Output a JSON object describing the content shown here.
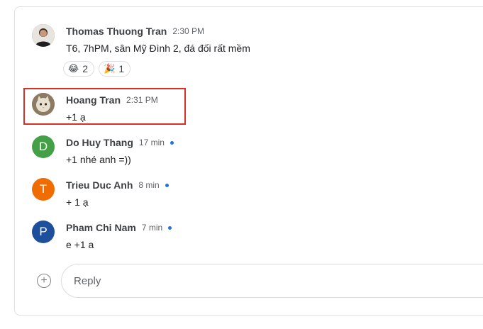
{
  "messages": [
    {
      "author": "Thomas Thuong Tran",
      "time": "2:30 PM",
      "text": "T6, 7hPM, sân Mỹ Đình 2, đá đối rất mềm",
      "avatar_icon": "photo-avatar",
      "reactions": [
        {
          "emoji": "😂",
          "count": "2"
        },
        {
          "emoji": "🎉",
          "count": "1"
        }
      ]
    },
    {
      "author": "Hoang Tran",
      "time": "2:31 PM",
      "text": "+1 ạ",
      "avatar_icon": "photo-avatar"
    },
    {
      "author": "Do Huy Thang",
      "time": "17 min",
      "text": "+1 nhé anh =))",
      "avatar_letter": "D",
      "avatar_color": "#43a047",
      "unread": true
    },
    {
      "author": "Trieu Duc Anh",
      "time": "8 min",
      "text": "+ 1 ạ",
      "avatar_letter": "T",
      "avatar_color": "#ef6c00",
      "unread": true
    },
    {
      "author": "Pham Chi Nam",
      "time": "7 min",
      "text": "e +1 a",
      "avatar_letter": "P",
      "avatar_color": "#1e4f9c",
      "unread": true
    }
  ],
  "composer": {
    "placeholder": "Reply",
    "add_icon": "plus-circle-icon"
  },
  "colors": {
    "highlight": "#d93025",
    "unread_dot": "#1a73e8"
  }
}
